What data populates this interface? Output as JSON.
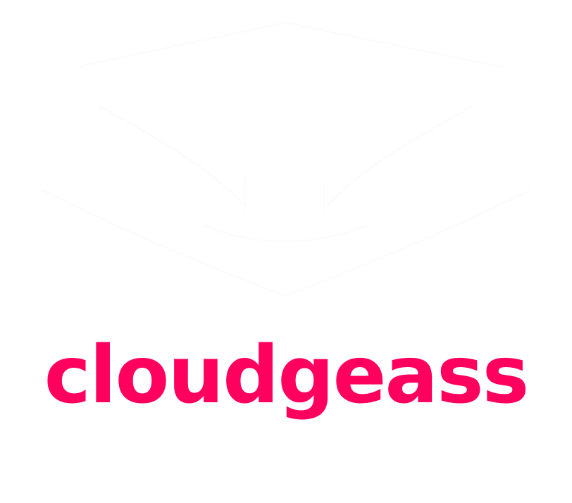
{
  "logo": {
    "wordmark": "cloudgeass",
    "wordmark_color": "#ff005f",
    "background_color": "#ffffff",
    "emblem_icon": "white-cloud-emblem-icon"
  }
}
